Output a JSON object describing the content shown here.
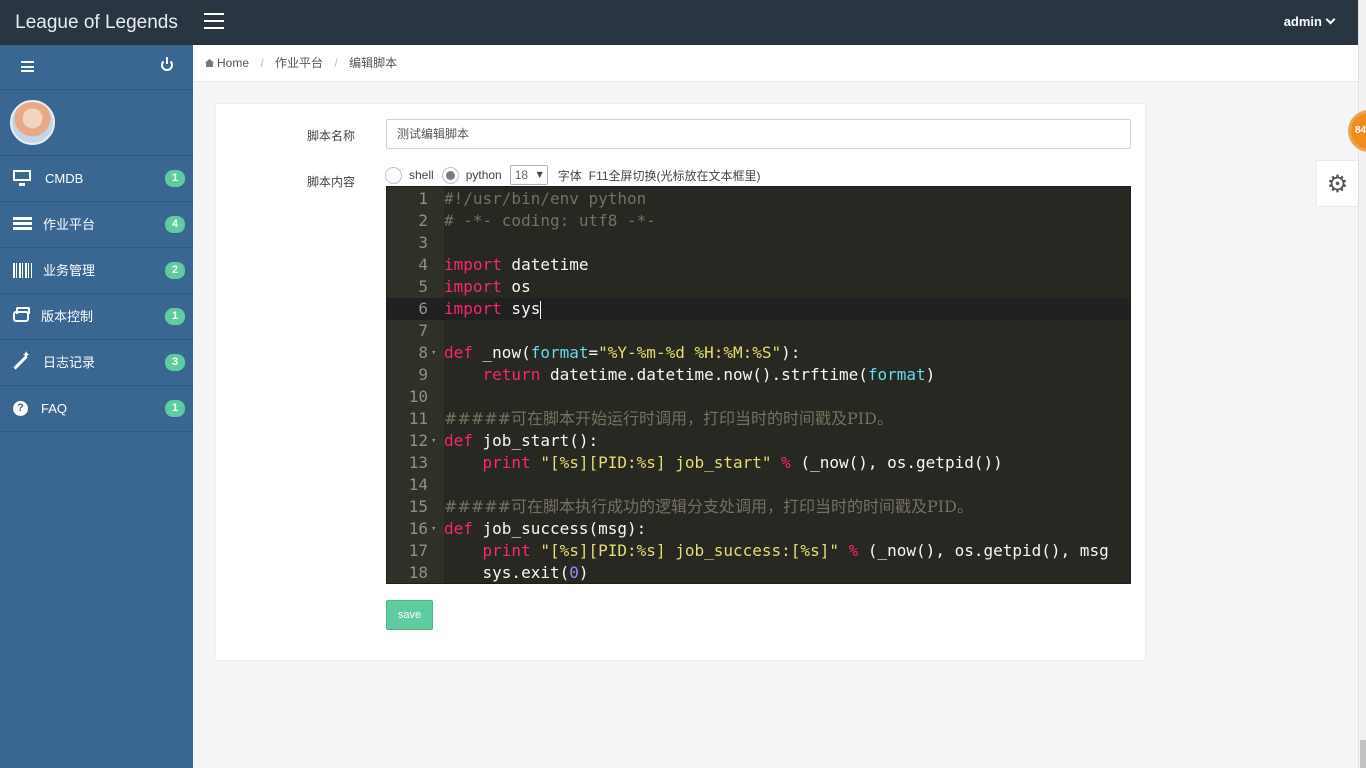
{
  "app": {
    "title": "League of Legends",
    "user": "admin"
  },
  "sidebar": {
    "items": [
      {
        "label": "CMDB",
        "badge": "1",
        "icon": "desktop-icon"
      },
      {
        "label": "作业平台",
        "badge": "4",
        "icon": "tasks-icon"
      },
      {
        "label": "业务管理",
        "badge": "2",
        "icon": "barcode-icon"
      },
      {
        "label": "版本控制",
        "badge": "1",
        "icon": "hdd-icon"
      },
      {
        "label": "日志记录",
        "badge": "3",
        "icon": "magic-wand-icon"
      },
      {
        "label": "FAQ",
        "badge": "1",
        "icon": "question-circle-icon"
      }
    ]
  },
  "breadcrumb": {
    "home": "Home",
    "section": "作业平台",
    "page": "编辑脚本"
  },
  "form": {
    "name_label": "脚本名称",
    "name_value": "测试编辑脚本",
    "content_label": "脚本内容",
    "lang_shell": "shell",
    "lang_python": "python",
    "selected_lang": "python",
    "font_size": "18",
    "font_label": "字体",
    "fullscreen_hint": "F11全屏切换(光标放在文本框里)",
    "save_label": "save"
  },
  "editor": {
    "active_line": 6,
    "lines": [
      "#!/usr/bin/env python",
      "# -*- coding: utf8 -*-",
      "",
      "import datetime",
      "import os",
      "import sys",
      "",
      "def _now(format=\"%Y-%m-%d %H:%M:%S\"):",
      "    return datetime.datetime.now().strftime(format)",
      "",
      "#####可在脚本开始运行时调用，打印当时的时间戳及PID。",
      "def job_start():",
      "    print \"[%s][PID:%s] job_start\" % (_now(), os.getpid())",
      "",
      "#####可在脚本执行成功的逻辑分支处调用，打印当时的时间戳及PID。",
      "def job_success(msg):",
      "    print \"[%s][PID:%s] job_success:[%s]\" % (_now(), os.getpid(), msg",
      "    sys.exit(0)"
    ]
  },
  "widgets": {
    "bubble_text": "84"
  },
  "colors": {
    "topbar": "#2a3542",
    "sidebar": "#3a6792",
    "badge": "#5ecba0",
    "editor_bg": "#272822",
    "save_button": "#5ecba0",
    "bubble": "#f08c1d"
  }
}
